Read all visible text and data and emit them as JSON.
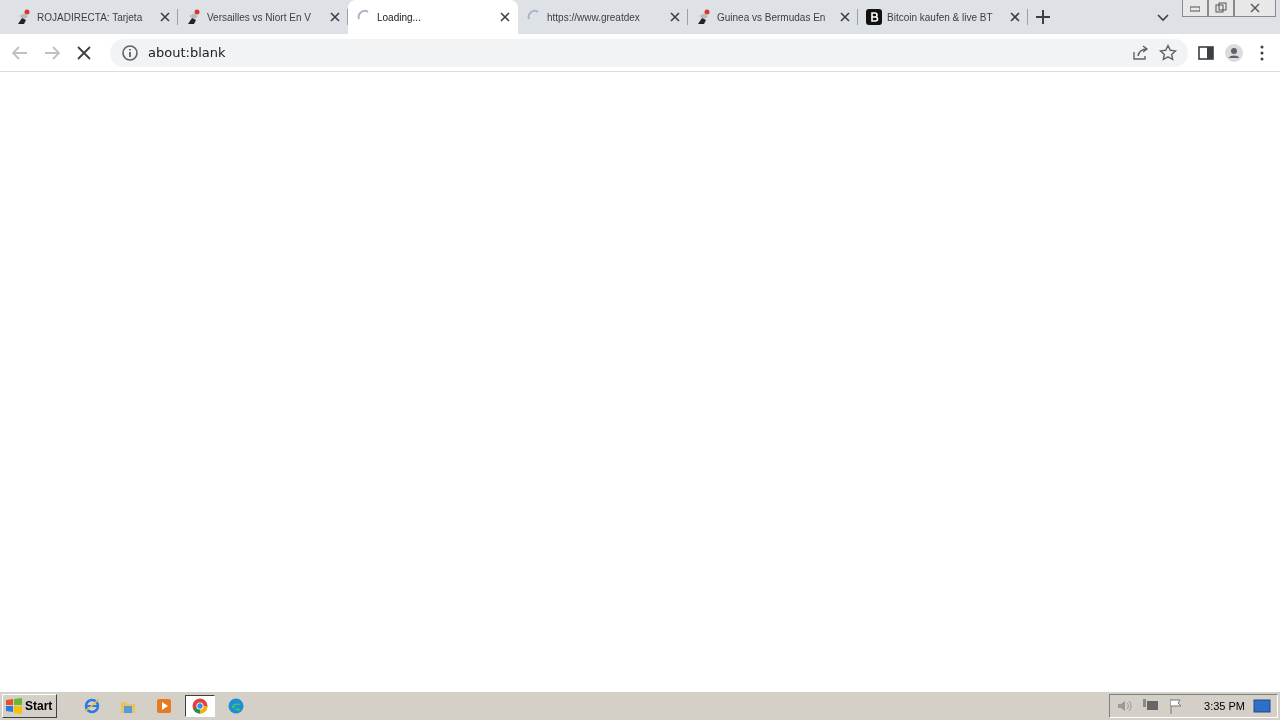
{
  "tabs": [
    {
      "title": "ROJADIRECTA: Tarjeta",
      "kind": "figure",
      "selected": false
    },
    {
      "title": "Versailles vs Niort En V",
      "kind": "figure",
      "selected": false
    },
    {
      "title": "Loading...",
      "kind": "spinner",
      "selected": true
    },
    {
      "title": "https://www.greatdex",
      "kind": "spinner",
      "selected": false
    },
    {
      "title": "Guinea vs Bermudas En",
      "kind": "figure",
      "selected": false
    },
    {
      "title": "Bitcoin kaufen & live BT",
      "kind": "bitcoin",
      "selected": false
    }
  ],
  "address_bar": {
    "value": "about:blank"
  },
  "taskbar": {
    "start": "Start",
    "apps": [
      {
        "kind": "ie",
        "selected": false
      },
      {
        "kind": "folder",
        "selected": false
      },
      {
        "kind": "media",
        "selected": false
      },
      {
        "kind": "chrome",
        "selected": true
      },
      {
        "kind": "edge",
        "selected": false
      }
    ],
    "clock": "3:35 PM"
  }
}
